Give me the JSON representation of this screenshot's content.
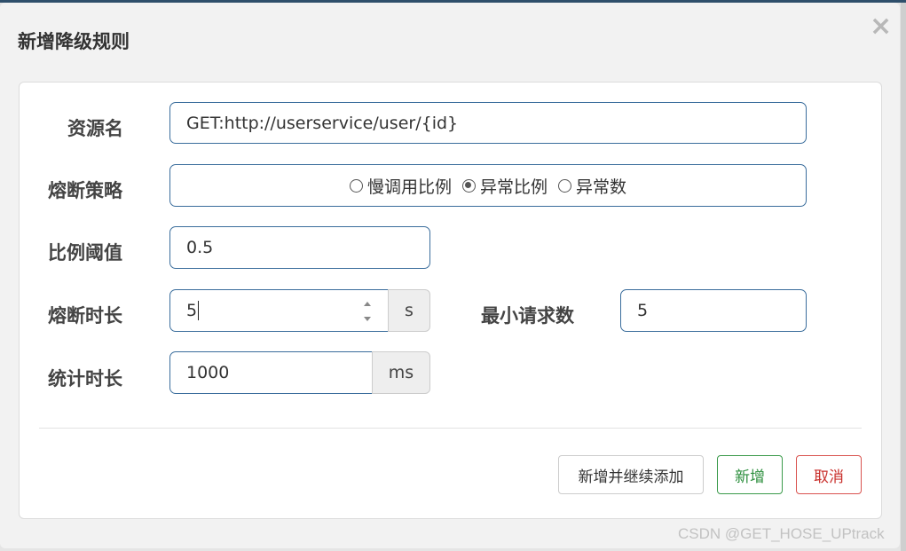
{
  "dialog": {
    "title": "新增降级规则",
    "close_label": "×"
  },
  "form": {
    "resource": {
      "label": "资源名",
      "value": "GET:http://userservice/user/{id}"
    },
    "strategy": {
      "label": "熔断策略",
      "options": [
        {
          "label": "慢调用比例",
          "checked": false
        },
        {
          "label": "异常比例",
          "checked": true
        },
        {
          "label": "异常数",
          "checked": false
        }
      ]
    },
    "ratio_threshold": {
      "label": "比例阈值",
      "value": "0.5"
    },
    "break_duration": {
      "label": "熔断时长",
      "value": "5",
      "unit": "s"
    },
    "min_requests": {
      "label": "最小请求数",
      "value": "5"
    },
    "stat_duration": {
      "label": "统计时长",
      "value": "1000",
      "unit": "ms"
    }
  },
  "buttons": {
    "add_continue": "新增并继续添加",
    "add": "新增",
    "cancel": "取消"
  },
  "watermark": "CSDN @GET_HOSE_UPtrack"
}
